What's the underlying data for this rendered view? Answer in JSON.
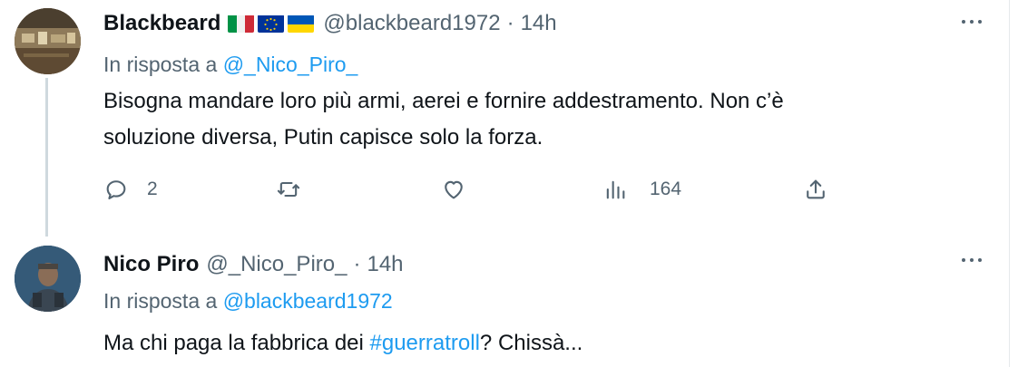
{
  "tweets": [
    {
      "author_name": "Blackbeard",
      "flags": [
        "italy-flag-icon",
        "eu-flag-icon",
        "ukraine-flag-icon"
      ],
      "handle": "@blackbeard1972",
      "time": "14h",
      "reply_prefix": "In risposta a",
      "reply_to": "@_Nico_Piro_",
      "text_line1": "Bisogna mandare loro più armi, aerei e fornire addestramento. Non c’è",
      "text_line2": "soluzione diversa, Putin capisce solo la forza.",
      "replies": "2",
      "views": "164"
    },
    {
      "author_name": "Nico Piro",
      "handle": "@_Nico_Piro_",
      "time": "14h",
      "reply_prefix": "In risposta a",
      "reply_to": "@blackbeard1972",
      "text_before": "Ma chi paga la fabbrica dei ",
      "hashtag": "#guerratroll",
      "text_after": "? Chissà..."
    }
  ],
  "separator": "·",
  "colors": {
    "link": "#1d9bf0",
    "secondary": "#536471",
    "text": "#0f1419",
    "thread_line": "#cfd9de"
  }
}
